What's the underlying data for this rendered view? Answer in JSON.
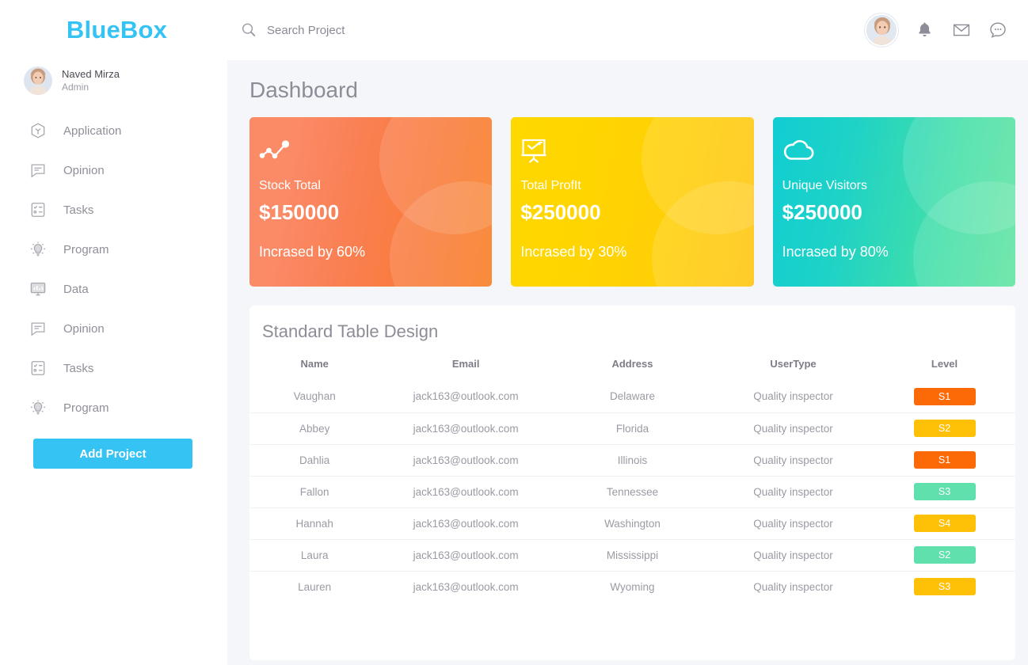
{
  "brand": {
    "name": "BlueBox",
    "color": "#35c3f3"
  },
  "sidebar": {
    "profile": {
      "name": "Naved Mirza",
      "role": "Admin"
    },
    "items": [
      {
        "label": "Application",
        "icon": "cube-icon"
      },
      {
        "label": "Opinion",
        "icon": "comment-icon"
      },
      {
        "label": "Tasks",
        "icon": "checklist-icon"
      },
      {
        "label": "Program",
        "icon": "lightbulb-icon"
      },
      {
        "label": "Data",
        "icon": "monitor-chart-icon"
      },
      {
        "label": "Opinion",
        "icon": "comment-icon"
      },
      {
        "label": "Tasks",
        "icon": "checklist-icon"
      },
      {
        "label": "Program",
        "icon": "lightbulb-icon"
      }
    ],
    "add_project_label": "Add Project"
  },
  "topbar": {
    "search": {
      "placeholder": "Search Project",
      "value": "",
      "icon": "search-icon"
    },
    "icons": [
      "avatar",
      "bell-icon",
      "envelope-icon",
      "chat-icon"
    ]
  },
  "main": {
    "page_title": "Dashboard",
    "cards": [
      {
        "label": "Stock Total",
        "value": "$150000",
        "sub": "Incrased by 60%",
        "icon": "line-chart-nodes-icon",
        "theme": "card-orange",
        "color": "#f97a37"
      },
      {
        "label": "Total ProfIt",
        "value": "$250000",
        "sub": "Incrased by 30%",
        "icon": "presentation-chart-icon",
        "theme": "card-yellow",
        "color": "#ffd000"
      },
      {
        "label": "Unique Visitors",
        "value": "$250000",
        "sub": "Incrased by 80%",
        "icon": "cloud-icon",
        "theme": "card-teal",
        "color": "#1ed2c6"
      }
    ],
    "table": {
      "title": "Standard Table Design",
      "columns": [
        "Name",
        "Email",
        "Address",
        "UserType",
        "Level"
      ],
      "rows": [
        {
          "name": "Vaughan",
          "email": "jack163@outlook.com",
          "address": "Delaware",
          "usertype": "Quality inspector",
          "level": "S1",
          "level_theme": "badge-orange"
        },
        {
          "name": "Abbey",
          "email": "jack163@outlook.com",
          "address": "Florida",
          "usertype": "Quality inspector",
          "level": "S2",
          "level_theme": "badge-amber"
        },
        {
          "name": "Dahlia",
          "email": "jack163@outlook.com",
          "address": "Illinois",
          "usertype": "Quality inspector",
          "level": "S1",
          "level_theme": "badge-orange"
        },
        {
          "name": "Fallon",
          "email": "jack163@outlook.com",
          "address": "Tennessee",
          "usertype": "Quality inspector",
          "level": "S3",
          "level_theme": "badge-green"
        },
        {
          "name": "Hannah",
          "email": "jack163@outlook.com",
          "address": "Washington",
          "usertype": "Quality inspector",
          "level": "S4",
          "level_theme": "badge-amber"
        },
        {
          "name": "Laura",
          "email": "jack163@outlook.com",
          "address": "Mississippi",
          "usertype": "Quality inspector",
          "level": "S2",
          "level_theme": "badge-green"
        },
        {
          "name": "Lauren",
          "email": "jack163@outlook.com",
          "address": "Wyoming",
          "usertype": "Quality inspector",
          "level": "S3",
          "level_theme": "badge-amber"
        }
      ]
    }
  }
}
